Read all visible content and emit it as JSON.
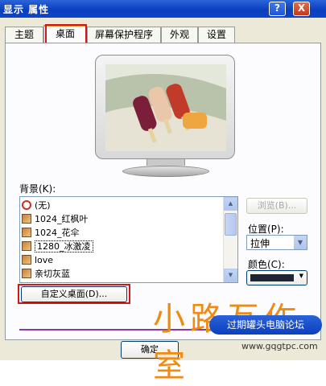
{
  "window": {
    "title": "显示 属性"
  },
  "titlebar": {
    "help": "?",
    "close": "X"
  },
  "tabs": [
    "主题",
    "桌面",
    "屏幕保护程序",
    "外观",
    "设置"
  ],
  "background": {
    "label": "背景(K):",
    "items": [
      "(无)",
      "1024_红枫叶",
      "1024_花伞",
      "1280_冰激凌",
      "love",
      "亲切灰蓝"
    ],
    "selected_index": 3
  },
  "buttons": {
    "browse": "浏览(B)...",
    "customize": "自定义桌面(D)...",
    "ok": "确定"
  },
  "position": {
    "label": "位置(P):",
    "value": "拉伸"
  },
  "color": {
    "label": "颜色(C):",
    "value_hex": "#1E2633"
  },
  "overlay": {
    "watermark_text": "小路互作室",
    "badge_text": "过期罐头电脑论坛",
    "url": "www.gqgtpc.com"
  },
  "colors": {
    "highlight": "#D01818",
    "accent_watermark": "#F08A10"
  }
}
